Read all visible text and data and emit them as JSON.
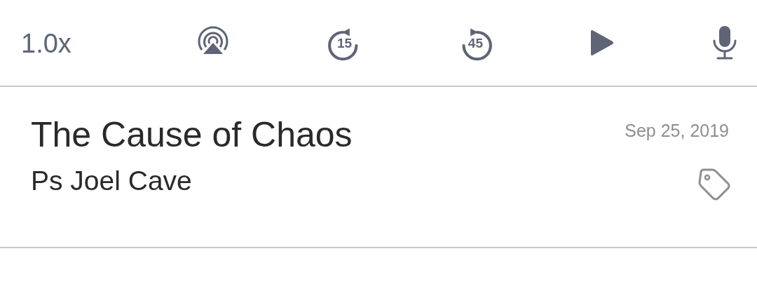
{
  "toolbar": [
    {
      "kind": "speed",
      "label": "1.0x"
    },
    {
      "kind": "airplay"
    },
    {
      "kind": "skip_back",
      "label": "15"
    },
    {
      "kind": "skip_forward",
      "label": "45"
    },
    {
      "kind": "play"
    },
    {
      "kind": "mic"
    }
  ],
  "episode": {
    "title": "The Cause of Chaos",
    "date": "Sep 25, 2019",
    "speaker": "Ps Joel Cave",
    "tagged": false
  }
}
